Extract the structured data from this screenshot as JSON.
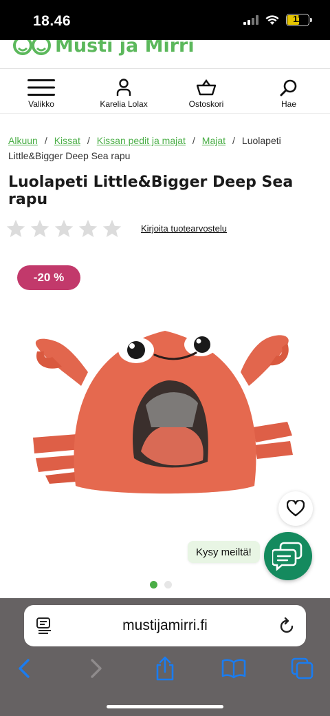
{
  "status": {
    "time": "18.46",
    "battery": "11"
  },
  "logo": {
    "text": "Musti ja Mirri"
  },
  "nav": {
    "menu_label": "Valikko",
    "account_label": "Karelia Lolax",
    "cart_label": "Ostoskori",
    "search_label": "Hae"
  },
  "breadcrumb": {
    "items": [
      "Alkuun",
      "Kissat",
      "Kissan pedit ja majat",
      "Majat"
    ],
    "current": "Luolapeti Little&Bigger Deep Sea rapu",
    "separator": "/"
  },
  "product": {
    "title": "Luolapeti Little&Bigger Deep Sea rapu",
    "rating": 0,
    "rating_max": 5,
    "review_link": "Kirjoita tuotearvostelu",
    "discount_badge": "-20 %",
    "image_icon": "crab-cave-bed-image"
  },
  "carousel": {
    "count": 2,
    "active": 1
  },
  "chat": {
    "bubble_text": "Kysy meiltä!"
  },
  "browser": {
    "url": "mustijamirri.fi"
  },
  "colors": {
    "brand_green": "#4aae46",
    "discount_pink": "#c2396b",
    "chat_green": "#148a5e",
    "browser_gray": "#666263",
    "ios_blue": "#1a7cf0"
  }
}
